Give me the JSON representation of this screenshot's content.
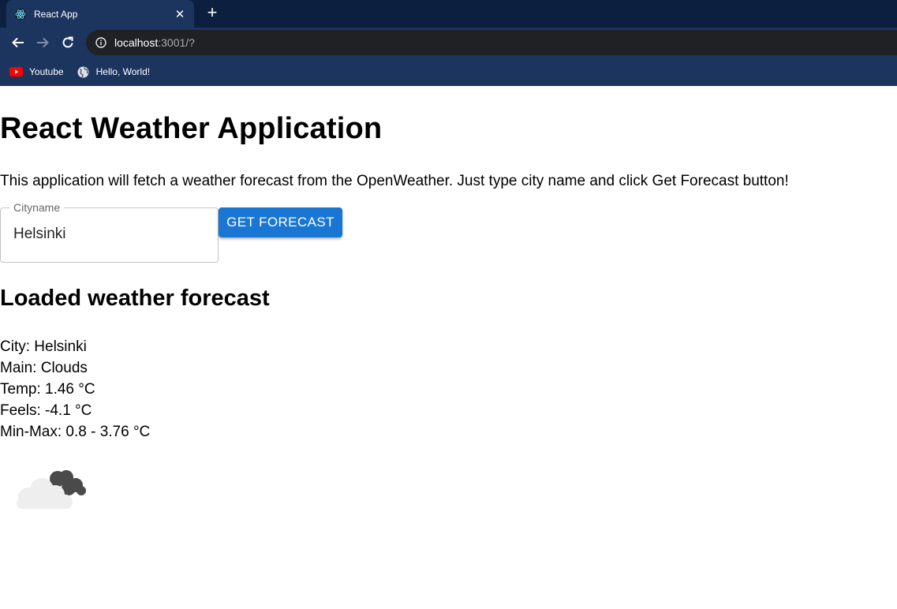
{
  "browser": {
    "tab_title": "React App",
    "url_host": "localhost",
    "url_rest": ":3001/?",
    "bookmarks": [
      {
        "label": "Youtube",
        "icon": "youtube-icon"
      },
      {
        "label": "Hello, World!",
        "icon": "globe-icon"
      }
    ]
  },
  "app": {
    "title": "React Weather Application",
    "intro": "This application will fetch a weather forecast from the OpenWeather. Just type city name and click Get Forecast button!",
    "city_field": {
      "label": "Cityname",
      "value": "Helsinki"
    },
    "button_label": "GET FORECAST",
    "forecast_title": "Loaded weather forecast",
    "forecast": {
      "city": "City: Helsinki",
      "main": "Main: Clouds",
      "temp": "Temp: 1.46 °C",
      "feels": "Feels: -4.1 °C",
      "minmax": "Min-Max: 0.8 - 3.76 °C"
    },
    "weather_icon": "broken-clouds-icon"
  },
  "colors": {
    "chrome_dark": "#0c1f3f",
    "chrome": "#1c355f",
    "button": "#1976d2"
  }
}
